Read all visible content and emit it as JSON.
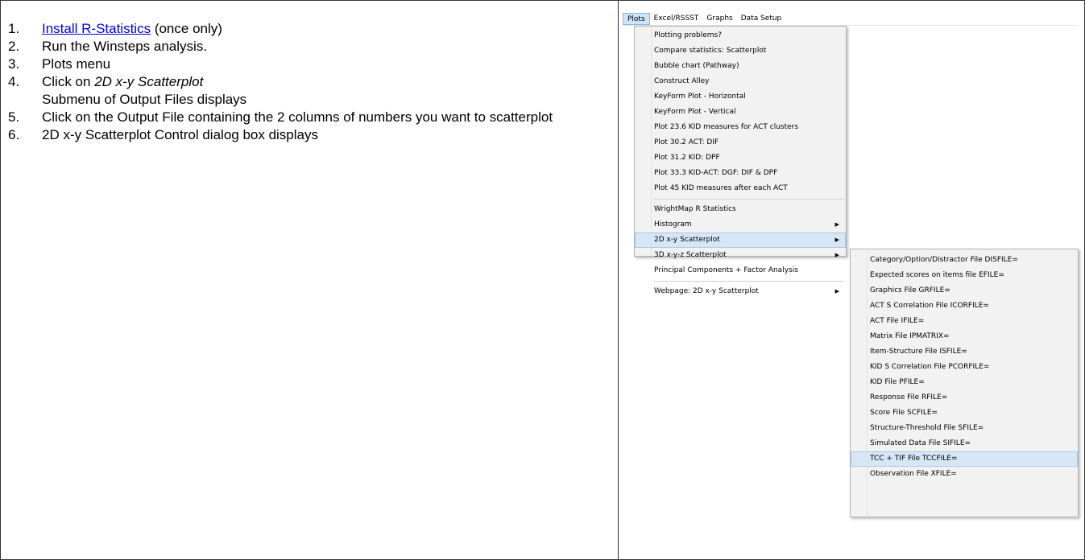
{
  "steps": [
    {
      "num": "1.",
      "link": "Install R-Statistics",
      "after": " (once only)"
    },
    {
      "num": "2.",
      "text": "Run the Winsteps analysis."
    },
    {
      "num": "3.",
      "text": "Plots menu"
    },
    {
      "num": "4.",
      "before": "Click on ",
      "emph": "2D x-y Scatterplot",
      "line2": "Submenu of Output Files displays"
    },
    {
      "num": "5.",
      "text": "Click on the Output File containing the 2 columns of numbers you want to scatterplot"
    },
    {
      "num": "6.",
      "text": "2D x-y Scatterplot Control dialog box displays"
    }
  ],
  "menubar": [
    "Plots",
    "Excel/RSSST",
    "Graphs",
    "Data Setup"
  ],
  "plots_menu": {
    "group1": [
      "Plotting problems?",
      "Compare statistics: Scatterplot",
      "Bubble chart (Pathway)",
      "Construct Alley",
      "KeyForm Plot - Horizontal",
      "KeyForm Plot - Vertical",
      "Plot 23.6 KID measures for ACT clusters",
      "Plot 30.2 ACT: DIF",
      "Plot 31.2 KID: DPF",
      "Plot 33.3 KID-ACT: DGF: DIF & DPF",
      "Plot 45 KID measures after each ACT"
    ],
    "group2": [
      "WrightMap R Statistics",
      "Histogram",
      "2D x-y Scatterplot",
      "3D x-y-z Scatterplot",
      "Principal Components + Factor Analysis"
    ],
    "group3": [
      "Webpage: 2D x-y Scatterplot"
    ]
  },
  "submenu": [
    "Category/Option/Distractor File DISFILE=",
    "Expected scores on items file EFILE=",
    "Graphics File GRFILE=",
    "ACT S Correlation File ICORFILE=",
    "ACT File IFILE=",
    "Matrix File IPMATRIX=",
    "Item-Structure File ISFILE=",
    "KID S Correlation File PCORFILE=",
    "KID File PFILE=",
    "Response File RFILE=",
    "Score File SCFILE=",
    "Structure-Threshold File SFILE=",
    "Simulated Data File SIFILE=",
    "TCC + TIF File TCCFILE=",
    "Observation File XFILE="
  ]
}
